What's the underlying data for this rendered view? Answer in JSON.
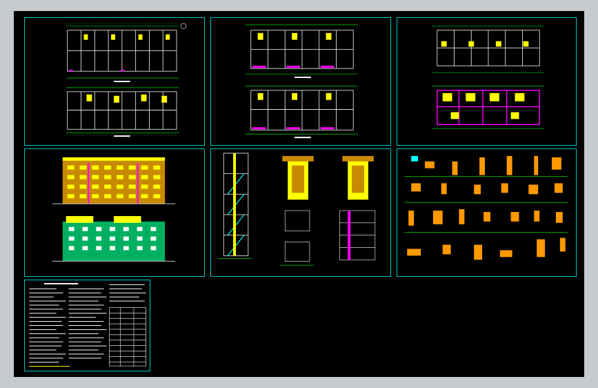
{
  "colors": {
    "background": "#000000",
    "frame": "#c7cace",
    "border": "#00c8c8",
    "wall": "#ffffff",
    "dimension": "#00ff00",
    "highlight": "#ffff00",
    "accent": "#ff00ff",
    "cyan": "#00ffff",
    "orange": "#ff9900",
    "red": "#ff0000"
  },
  "icons": {
    "north": "north-arrow-icon"
  }
}
